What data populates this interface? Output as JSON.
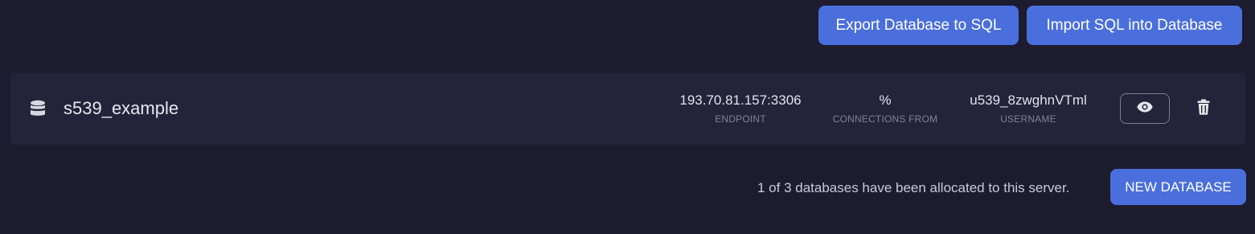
{
  "toolbar": {
    "export_label": "Export Database to SQL",
    "import_label": "Import SQL into Database"
  },
  "database": {
    "icon": "database-icon",
    "name": "s539_example",
    "endpoint": {
      "value": "193.70.81.157:3306",
      "label": "ENDPOINT"
    },
    "connections": {
      "value": "%",
      "label": "CONNECTIONS FROM"
    },
    "username": {
      "value": "u539_8zwghnVTml",
      "label": "USERNAME"
    },
    "view_icon": "eye-icon",
    "delete_icon": "trash-icon"
  },
  "footer": {
    "allocation_text": "1 of 3 databases have been allocated to this server.",
    "new_database_label": "NEW DATABASE"
  },
  "colors": {
    "background": "#1c1c2e",
    "row_background": "#23243a",
    "accent": "#4a6fdc",
    "muted_label": "#7d819a"
  }
}
